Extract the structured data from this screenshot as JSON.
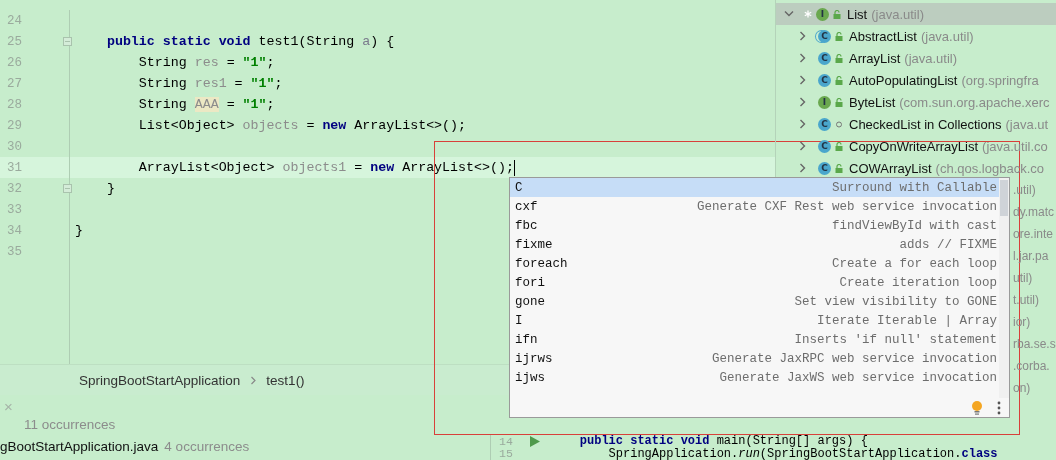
{
  "editor": {
    "lines": [
      {
        "number": "24"
      },
      {
        "number": "25",
        "fold": true,
        "tokens": [
          {
            "text": "    public",
            "kind": "keyword"
          },
          {
            "text": " static",
            "kind": "keyword"
          },
          {
            "text": " void",
            "kind": "keyword"
          },
          {
            "text": " test1(String ",
            "kind": "plain"
          },
          {
            "text": "a",
            "kind": "param"
          },
          {
            "text": ") {",
            "kind": "plain"
          }
        ]
      },
      {
        "number": "26",
        "tokens": [
          {
            "text": "        String ",
            "kind": "plain"
          },
          {
            "text": "res",
            "kind": "unused"
          },
          {
            "text": " = ",
            "kind": "plain"
          },
          {
            "text": "\"1\"",
            "kind": "string"
          },
          {
            "text": ";",
            "kind": "plain"
          }
        ]
      },
      {
        "number": "27",
        "tokens": [
          {
            "text": "        String ",
            "kind": "plain"
          },
          {
            "text": "res1",
            "kind": "unused"
          },
          {
            "text": " = ",
            "kind": "plain"
          },
          {
            "text": "\"1\"",
            "kind": "string"
          },
          {
            "text": ";",
            "kind": "plain"
          }
        ]
      },
      {
        "number": "28",
        "tokens": [
          {
            "text": "        String ",
            "kind": "plain"
          },
          {
            "text": "AAA",
            "kind": "warn"
          },
          {
            "text": " = ",
            "kind": "plain"
          },
          {
            "text": "\"1\"",
            "kind": "string"
          },
          {
            "text": ";",
            "kind": "plain"
          }
        ]
      },
      {
        "number": "29",
        "tokens": [
          {
            "text": "        List<Object> ",
            "kind": "plain"
          },
          {
            "text": "objects",
            "kind": "unused"
          },
          {
            "text": " = ",
            "kind": "plain"
          },
          {
            "text": "new",
            "kind": "keyword"
          },
          {
            "text": " ArrayList<>();",
            "kind": "plain"
          }
        ]
      },
      {
        "number": "30"
      },
      {
        "number": "31",
        "current": true,
        "caret": true,
        "tokens": [
          {
            "text": "        ArrayList<Object> ",
            "kind": "plain"
          },
          {
            "text": "objects1",
            "kind": "unused"
          },
          {
            "text": " = ",
            "kind": "plain"
          },
          {
            "text": "new",
            "kind": "keyword"
          },
          {
            "text": " ArrayList<>();",
            "kind": "plain"
          }
        ]
      },
      {
        "number": "32",
        "fold": true,
        "tokens": [
          {
            "text": "    }",
            "kind": "plain"
          }
        ]
      },
      {
        "number": "33"
      },
      {
        "number": "34",
        "tokens": [
          {
            "text": "}",
            "kind": "plain"
          }
        ]
      },
      {
        "number": "35"
      }
    ],
    "breadcrumb": [
      "SpringBootStartApplication",
      "test1()"
    ]
  },
  "hierarchy": {
    "root": {
      "kind": "interface",
      "badge": "I",
      "public": true,
      "pinned": true,
      "name": "List",
      "package": "(java.util)",
      "expanded": true,
      "selected": true,
      "children": [
        {
          "kind": "abstract",
          "badge": "C",
          "public": true,
          "name": "AbstractList",
          "package": "(java.util)",
          "expanded": false,
          "selected": false
        },
        {
          "kind": "class",
          "badge": "C",
          "public": true,
          "name": "ArrayList",
          "package": "(java.util)",
          "expanded": false,
          "selected": false
        },
        {
          "kind": "class",
          "badge": "C",
          "public": true,
          "name": "AutoPopulatingList",
          "package": "(org.springfra",
          "expanded": false,
          "selected": false
        },
        {
          "kind": "interface",
          "badge": "I",
          "public": true,
          "name": "ByteList",
          "package": "(com.sun.org.apache.xerc",
          "expanded": false,
          "selected": false
        },
        {
          "kind": "class",
          "badge": "C",
          "public": false,
          "name": "CheckedList in Collections",
          "package": "(java.ut",
          "expanded": false,
          "selected": false
        },
        {
          "kind": "class",
          "badge": "C",
          "public": true,
          "name": "CopyOnWriteArrayList",
          "package": "(java.util.co",
          "expanded": false,
          "selected": false
        },
        {
          "kind": "class",
          "badge": "C",
          "public": true,
          "name": "COWArrayList",
          "package": "(ch.qos.logback.co",
          "expanded": false,
          "selected": false
        },
        {
          "kind": "partial",
          "tail": ".util)"
        },
        {
          "kind": "partial",
          "tail": "dy.matc"
        },
        {
          "kind": "partial",
          "tail": "ore.inte"
        },
        {
          "kind": "partial",
          "tail": "l.jar.pa"
        },
        {
          "kind": "partial",
          "tail": "util)"
        },
        {
          "kind": "partial",
          "tail": "t.util)"
        },
        {
          "kind": "partial",
          "tail": "ior)"
        },
        {
          "kind": "partial",
          "tail": "rba.se.s"
        },
        {
          "kind": "partial",
          "tail": ".corba."
        },
        {
          "kind": "partial",
          "tail": "on)"
        }
      ]
    }
  },
  "completion": {
    "items": [
      {
        "abbr": "C",
        "desc": "Surround with Callable",
        "selected": true
      },
      {
        "abbr": "cxf",
        "desc": "Generate CXF Rest web service invocation",
        "selected": false
      },
      {
        "abbr": "fbc",
        "desc": "findViewById with cast",
        "selected": false
      },
      {
        "abbr": "fixme",
        "desc": "adds // FIXME",
        "selected": false
      },
      {
        "abbr": "foreach",
        "desc": "Create a for each loop",
        "selected": false
      },
      {
        "abbr": "fori",
        "desc": "Create iteration loop",
        "selected": false
      },
      {
        "abbr": "gone",
        "desc": "Set view visibility to GONE",
        "selected": false
      },
      {
        "abbr": "I",
        "desc": "Iterate Iterable | Array",
        "selected": false
      },
      {
        "abbr": "ifn",
        "desc": "Inserts 'if null' statement",
        "selected": false
      },
      {
        "abbr": "ijrws",
        "desc": "Generate JaxRPC web service invocation",
        "selected": false
      },
      {
        "abbr": "ijws",
        "desc": "Generate JaxWS web service invocation",
        "selected": false
      }
    ]
  },
  "find_panel": {
    "close": "×",
    "summary": "11 occurrences",
    "files": [
      {
        "name": "gBootStartApplication.java",
        "count": "4 occurrences"
      }
    ]
  },
  "preview_editor": {
    "lines": [
      {
        "number": "14",
        "run": true,
        "tokens": [
          {
            "text": "    public",
            "kind": "keyword"
          },
          {
            "text": " static",
            "kind": "keyword"
          },
          {
            "text": " void",
            "kind": "keyword"
          },
          {
            "text": " main(String[] args) {",
            "kind": "plain"
          }
        ]
      },
      {
        "number": "15",
        "tokens": [
          {
            "text": "        SpringApplication.",
            "kind": "plain"
          },
          {
            "text": "run",
            "kind": "italic"
          },
          {
            "text": "(SpringBootStartApplication.",
            "kind": "plain"
          },
          {
            "text": "class",
            "kind": "keyword"
          }
        ]
      }
    ]
  }
}
